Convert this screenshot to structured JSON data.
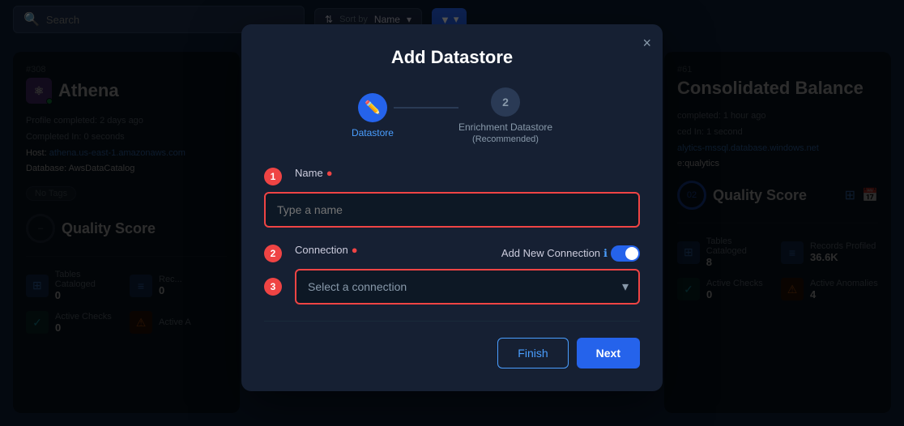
{
  "topbar": {
    "search_placeholder": "Search",
    "sort_label": "Sort by",
    "sort_value": "Name"
  },
  "left_card": {
    "id": "#308",
    "name": "Athena",
    "avatar_icon": "⚛",
    "profile_completed": "Profile completed: 2 days ago",
    "completed_in": "Completed In: 0 seconds",
    "host_label": "Host:",
    "host_value": "athena.us-east-1.amazonaws.com",
    "database_label": "Database:",
    "database_value": "AwsDataCatalog",
    "tags_label": "No Tags",
    "quality_label": "Quality Score",
    "tables_cataloged_label": "Tables Cataloged",
    "tables_cataloged_value": "0",
    "records_profiled_label": "Rec...",
    "records_profiled_value": "0",
    "active_checks_label": "Active Checks",
    "active_checks_value": "0",
    "active_anomalies_label": "Active A",
    "active_anomalies_value": ""
  },
  "right_card": {
    "id": "#61",
    "name": "Consolidated Balance",
    "profile_completed": "completed: 1 hour ago",
    "completed_in": "ced In: 1 second",
    "host_value": "alytics-mssql.database.windows.net",
    "db_label": "e:",
    "db_value": "qualytics",
    "quality_label": "Quality Score",
    "quality_value": "02",
    "tables_cataloged_label": "Tables Cataloged",
    "tables_cataloged_value": "8",
    "records_profiled_label": "Records Profiled",
    "records_profiled_value": "36.6K",
    "active_checks_label": "Active Checks",
    "active_checks_value": "0",
    "active_anomalies_label": "Active Anomalies",
    "active_anomalies_value": "4"
  },
  "modal": {
    "title": "Add Datastore",
    "close_label": "×",
    "step1_label": "Datastore",
    "step2_number": "2",
    "step2_label": "Enrichment Datastore",
    "step2_sublabel": "(Recommended)",
    "name_label": "Name",
    "name_placeholder": "Type a name",
    "connection_label": "Connection",
    "add_new_connection_label": "Add New Connection",
    "select_placeholder": "Select a connection",
    "finish_label": "Finish",
    "next_label": "Next",
    "step1_badge": "1",
    "step2_badge": "2",
    "step3_badge": "3"
  }
}
